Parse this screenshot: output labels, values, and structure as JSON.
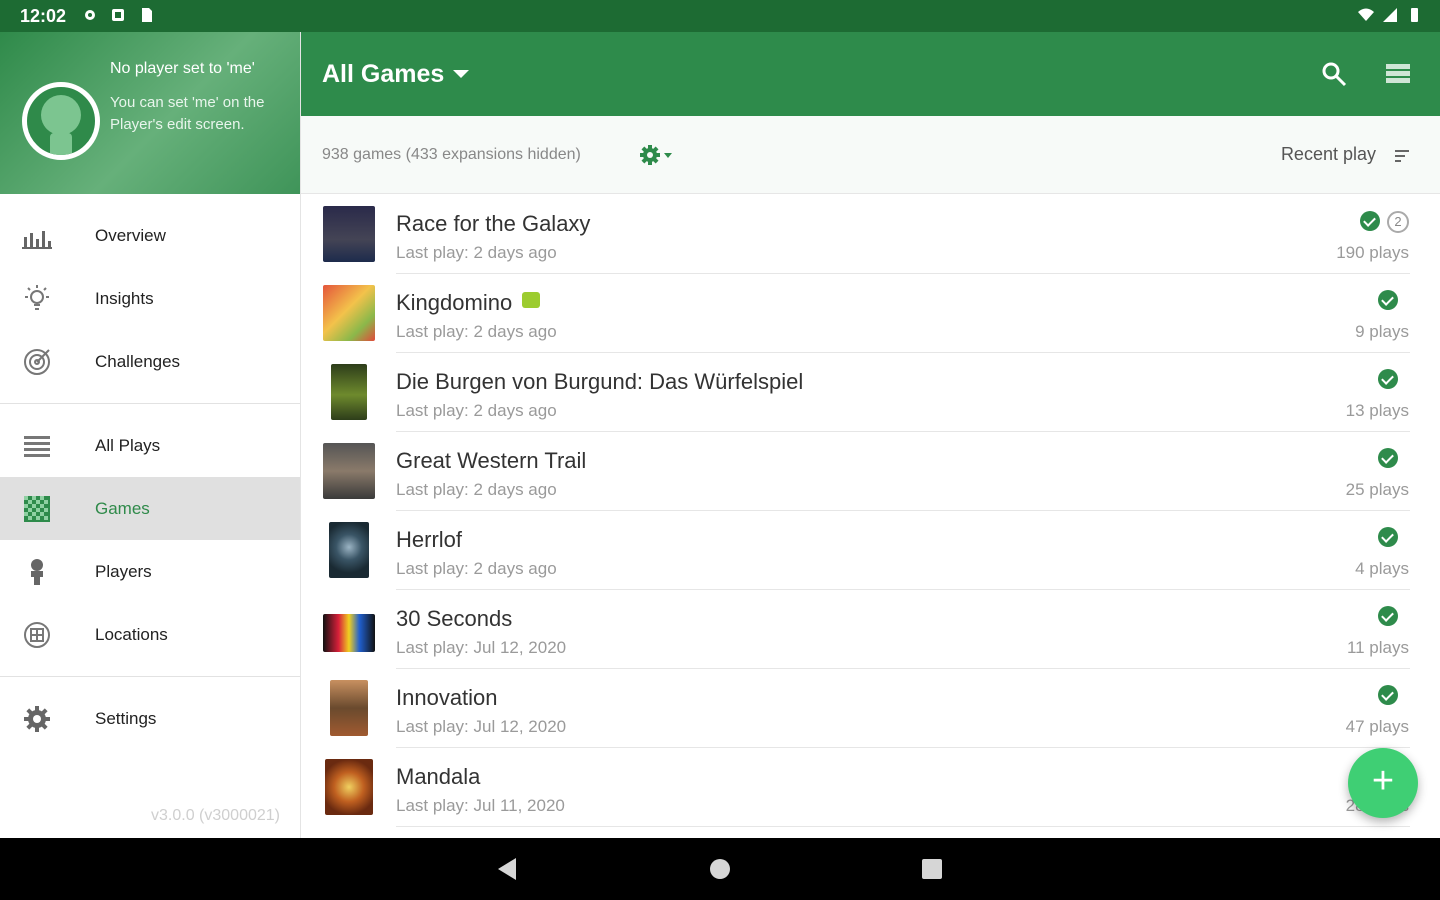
{
  "status_bar": {
    "time": "12:02"
  },
  "drawer": {
    "header_title": "No player set to 'me'",
    "header_subtitle": "You can set 'me' on the Player's edit screen.",
    "items": [
      {
        "label": "Overview",
        "icon": "bar-chart-icon"
      },
      {
        "label": "Insights",
        "icon": "lightbulb-icon"
      },
      {
        "label": "Challenges",
        "icon": "target-icon"
      },
      {
        "label": "All Plays",
        "icon": "list-icon"
      },
      {
        "label": "Games",
        "icon": "board-game-icon",
        "active": true
      },
      {
        "label": "Players",
        "icon": "person-icon"
      },
      {
        "label": "Locations",
        "icon": "location-icon"
      },
      {
        "label": "Settings",
        "icon": "gear-icon"
      }
    ],
    "version": "v3.0.0 (v3000021)"
  },
  "app_bar": {
    "title": "All Games"
  },
  "sub_bar": {
    "count": "938 games (433 expansions hidden)",
    "sort_label": "Recent play"
  },
  "games": [
    {
      "name": "Race for the Galaxy",
      "last_play": "Last play: 2 days ago",
      "plays": "190 plays",
      "badge": "2"
    },
    {
      "name": "Kingdomino",
      "last_play": "Last play: 2 days ago",
      "plays": "9 plays"
    },
    {
      "name": "Die Burgen von Burgund: Das Würfelspiel",
      "last_play": "Last play: 2 days ago",
      "plays": "13 plays"
    },
    {
      "name": "Great Western Trail",
      "last_play": "Last play: 2 days ago",
      "plays": "25 plays"
    },
    {
      "name": "Herrlof",
      "last_play": "Last play: 2 days ago",
      "plays": "4 plays"
    },
    {
      "name": "30 Seconds",
      "last_play": "Last play: Jul 12, 2020",
      "plays": "11 plays"
    },
    {
      "name": "Innovation",
      "last_play": "Last play: Jul 12, 2020",
      "plays": "47 plays"
    },
    {
      "name": "Mandala",
      "last_play": "Last play: Jul 11, 2020",
      "plays": "28 plays"
    }
  ],
  "colors": {
    "primary": "#2e8b4b",
    "status_bar": "#1d6b33",
    "fab": "#3fcf74"
  }
}
